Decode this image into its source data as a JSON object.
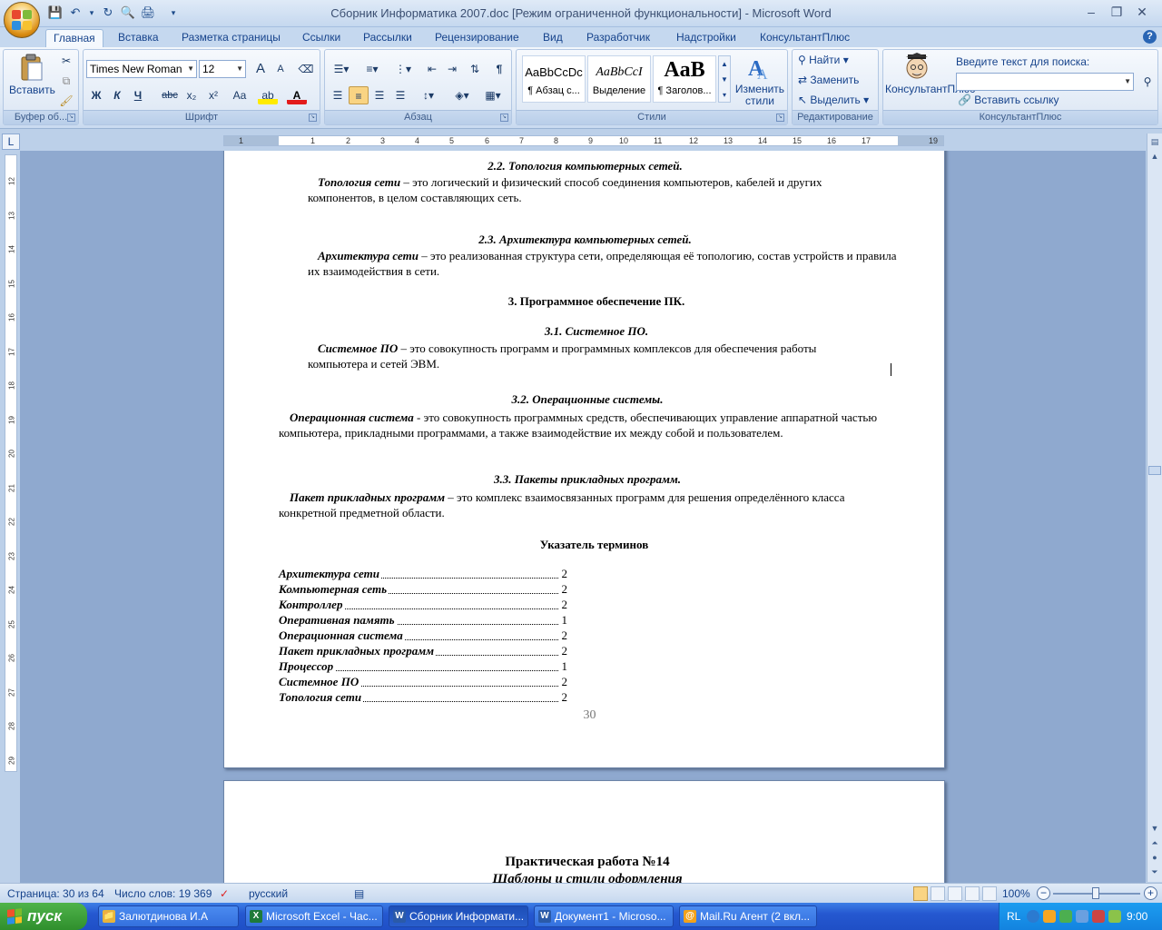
{
  "window": {
    "title": "Сборник Информатика 2007.doc [Режим ограниченной функциональности] - Microsoft Word",
    "minimize": "–",
    "restore": "❐",
    "close": "✕"
  },
  "qat": [
    "💾",
    "↶",
    "▾",
    "↻",
    "🔍",
    "🖨",
    "▾"
  ],
  "tabs": [
    "Главная",
    "Вставка",
    "Разметка страницы",
    "Ссылки",
    "Рассылки",
    "Рецензирование",
    "Вид",
    "Разработчик",
    "Надстройки",
    "КонсультантПлюс"
  ],
  "help_label": "?",
  "ribbon": {
    "clipboard": {
      "label": "Буфер об...",
      "paste": "Вставить"
    },
    "font": {
      "label": "Шрифт",
      "family": "Times New Roman",
      "size": "12",
      "grow": "A",
      "shrink": "A",
      "bold": "Ж",
      "italic": "К",
      "underline": "Ч",
      "strike": "abc",
      "sub": "x₂",
      "sup": "x²",
      "case": "Aa",
      "highlight": "ab",
      "color": "A"
    },
    "paragraph": {
      "label": "Абзац",
      "pilcrow": "¶"
    },
    "styles": {
      "label": "Стили",
      "tiles": [
        {
          "sample": "AaBbCcDc",
          "name": "¶ Абзац с..."
        },
        {
          "sample": "AaBbCcI",
          "name": "Выделение"
        },
        {
          "sample": "AaB",
          "name": "¶ Заголов..."
        }
      ],
      "change": "Изменить стили"
    },
    "editing": {
      "label": "Редактирование",
      "find": "Найти",
      "replace": "Заменить",
      "select": "Выделить"
    },
    "consultant": {
      "label": "КонсультантПлюс",
      "button": "КонсультантПлюс",
      "search_label": "Введите текст для поиска:",
      "insert_link": "Вставить ссылку"
    }
  },
  "ruler": {
    "corner": "L",
    "hnums": [
      "1",
      "1",
      "2",
      "3",
      "4",
      "5",
      "6",
      "7",
      "8",
      "9",
      "10",
      "11",
      "12",
      "13",
      "14",
      "15",
      "16",
      "17",
      "19"
    ],
    "vnums": [
      "12",
      "13",
      "14",
      "15",
      "16",
      "17",
      "18",
      "19",
      "20",
      "21",
      "22",
      "23",
      "24",
      "25",
      "26",
      "27",
      "28",
      "29"
    ]
  },
  "doc": {
    "h_topology": "2.2. Топология компьютерных сетей.",
    "topology_term": "Топология сети",
    "topology_text": " – это логический и физический способ соединения компьютеров, кабелей и других компонентов, в целом составляющих сеть.",
    "h_arch": "2.3. Архитектура компьютерных сетей.",
    "arch_term": "Архитектура сети",
    "arch_text": " – это реализованная структура сети, определяющая её топологию, состав устройств и правила их взаимодействия в сети.",
    "h_software": "3. Программное обеспечение ПК.",
    "h_system": "3.1. Системное ПО.",
    "system_term": "Системное ПО",
    "system_text": " – это совокупность программ и программных комплексов для обеспечения работы компьютера и сетей ЭВМ.",
    "h_os": "3.2. Операционные системы.",
    "os_term": "Операционная система",
    "os_text": " - это совокупность программных средств, обеспечивающих управление аппаратной частью компьютера, прикладными программами, а также взаимодействие их между собой и пользователем.",
    "h_apps": "3.3. Пакеты прикладных программ.",
    "apps_term": "Пакет прикладных программ",
    "apps_text": " – это комплекс взаимосвязанных программ для решения определённого класса конкретной предметной области.",
    "h_index": "Указатель терминов",
    "index": [
      {
        "term": "Архитектура сети",
        "page": "2"
      },
      {
        "term": "Компьютерная сеть",
        "page": "2"
      },
      {
        "term": "Контроллер",
        "page": "2"
      },
      {
        "term": "Оперативная память",
        "page": "1"
      },
      {
        "term": "Операционная система",
        "page": "2"
      },
      {
        "term": "Пакет прикладных программ",
        "page": "2"
      },
      {
        "term": "Процессор",
        "page": "1"
      },
      {
        "term": "Системное ПО",
        "page": "2"
      },
      {
        "term": "Топология сети",
        "page": "2"
      }
    ],
    "page_number": "30",
    "next_title": "Практическая работа №14",
    "next_subtitle": "Шаблоны и стили оформления"
  },
  "status": {
    "page": "Страница: 30 из 64",
    "words": "Число слов: 19 369",
    "lang": "русский",
    "zoom": "100%",
    "zoom_out": "−",
    "zoom_in": "+"
  },
  "taskbar": {
    "start": "пуск",
    "tasks": [
      {
        "label": "Залютдинова И.А",
        "icon": "📁",
        "color": "#e7b43c"
      },
      {
        "label": "Microsoft Excel - Час...",
        "icon": "X",
        "color": "#1e7a3a"
      },
      {
        "label": "Сборник Информати...",
        "icon": "W",
        "color": "#2b5aa8"
      },
      {
        "label": "Документ1 - Microso...",
        "icon": "W",
        "color": "#2b5aa8"
      },
      {
        "label": "Mail.Ru Агент (2 вкл...",
        "icon": "@",
        "color": "#f2a21a"
      }
    ],
    "lang": "RL",
    "time": "9:00"
  }
}
